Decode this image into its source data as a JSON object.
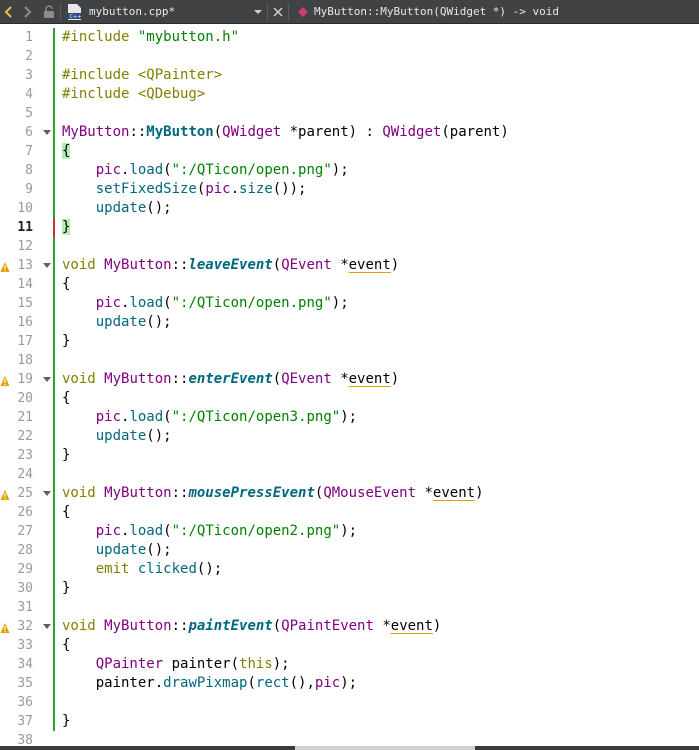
{
  "toolbar": {
    "file_name": "mybutton.cpp*",
    "symbol": "MyButton::MyButton(QWidget *) -> void",
    "file_badge": "C++"
  },
  "lines": [
    {
      "n": "1",
      "tokens": [
        [
          "kw",
          "#include "
        ],
        [
          "str",
          "\"mybutton.h\""
        ]
      ]
    },
    {
      "n": "2",
      "tokens": []
    },
    {
      "n": "3",
      "tokens": [
        [
          "kw",
          "#include "
        ],
        [
          "kw",
          "<QPainter>"
        ]
      ]
    },
    {
      "n": "4",
      "tokens": [
        [
          "kw",
          "#include "
        ],
        [
          "kw",
          "<QDebug>"
        ]
      ]
    },
    {
      "n": "5",
      "tokens": []
    },
    {
      "n": "6",
      "fold": true,
      "tokens": [
        [
          "ty",
          "MyButton"
        ],
        [
          "plain",
          "::"
        ],
        [
          "fnb",
          "MyButton"
        ],
        [
          "plain",
          "("
        ],
        [
          "ty",
          "QWidget"
        ],
        [
          "plain",
          " *parent) : "
        ],
        [
          "ty",
          "QWidget"
        ],
        [
          "plain",
          "(parent)"
        ]
      ]
    },
    {
      "n": "7",
      "tokens": [
        [
          "br",
          "{"
        ]
      ]
    },
    {
      "n": "8",
      "tokens": [
        [
          "plain",
          "    "
        ],
        [
          "ty",
          "pic"
        ],
        [
          "plain",
          "."
        ],
        [
          "fn",
          "load"
        ],
        [
          "plain",
          "("
        ],
        [
          "str",
          "\":/QTicon/open.png\""
        ],
        [
          "plain",
          ");"
        ]
      ]
    },
    {
      "n": "9",
      "tokens": [
        [
          "plain",
          "    "
        ],
        [
          "fn",
          "setFixedSize"
        ],
        [
          "plain",
          "("
        ],
        [
          "ty",
          "pic"
        ],
        [
          "plain",
          "."
        ],
        [
          "fn",
          "size"
        ],
        [
          "plain",
          "());"
        ]
      ]
    },
    {
      "n": "10",
      "tokens": [
        [
          "plain",
          "    "
        ],
        [
          "fn",
          "update"
        ],
        [
          "plain",
          "();"
        ]
      ]
    },
    {
      "n": "11",
      "current": true,
      "tokens": [
        [
          "br",
          "}"
        ]
      ]
    },
    {
      "n": "12",
      "tokens": []
    },
    {
      "n": "13",
      "warn": true,
      "fold": true,
      "tokens": [
        [
          "kw",
          "void "
        ],
        [
          "ty",
          "MyButton"
        ],
        [
          "plain",
          "::"
        ],
        [
          "fni",
          "leaveEvent"
        ],
        [
          "plain",
          "("
        ],
        [
          "ty",
          "QEvent"
        ],
        [
          "plain",
          " *"
        ],
        [
          "prm",
          "event"
        ],
        [
          "plain",
          ")"
        ]
      ]
    },
    {
      "n": "14",
      "tokens": [
        [
          "plain",
          "{"
        ]
      ]
    },
    {
      "n": "15",
      "tokens": [
        [
          "plain",
          "    "
        ],
        [
          "ty",
          "pic"
        ],
        [
          "plain",
          "."
        ],
        [
          "fn",
          "load"
        ],
        [
          "plain",
          "("
        ],
        [
          "str",
          "\":/QTicon/open.png\""
        ],
        [
          "plain",
          ");"
        ]
      ]
    },
    {
      "n": "16",
      "tokens": [
        [
          "plain",
          "    "
        ],
        [
          "fn",
          "update"
        ],
        [
          "plain",
          "();"
        ]
      ]
    },
    {
      "n": "17",
      "tokens": [
        [
          "plain",
          "}"
        ]
      ]
    },
    {
      "n": "18",
      "tokens": []
    },
    {
      "n": "19",
      "warn": true,
      "fold": true,
      "tokens": [
        [
          "kw",
          "void "
        ],
        [
          "ty",
          "MyButton"
        ],
        [
          "plain",
          "::"
        ],
        [
          "fni",
          "enterEvent"
        ],
        [
          "plain",
          "("
        ],
        [
          "ty",
          "QEvent"
        ],
        [
          "plain",
          " *"
        ],
        [
          "prm",
          "event"
        ],
        [
          "plain",
          ")"
        ]
      ]
    },
    {
      "n": "20",
      "tokens": [
        [
          "plain",
          "{"
        ]
      ]
    },
    {
      "n": "21",
      "tokens": [
        [
          "plain",
          "    "
        ],
        [
          "ty",
          "pic"
        ],
        [
          "plain",
          "."
        ],
        [
          "fn",
          "load"
        ],
        [
          "plain",
          "("
        ],
        [
          "str",
          "\":/QTicon/open3.png\""
        ],
        [
          "plain",
          ");"
        ]
      ]
    },
    {
      "n": "22",
      "tokens": [
        [
          "plain",
          "    "
        ],
        [
          "fn",
          "update"
        ],
        [
          "plain",
          "();"
        ]
      ]
    },
    {
      "n": "23",
      "tokens": [
        [
          "plain",
          "}"
        ]
      ]
    },
    {
      "n": "24",
      "tokens": []
    },
    {
      "n": "25",
      "warn": true,
      "fold": true,
      "tokens": [
        [
          "kw",
          "void "
        ],
        [
          "ty",
          "MyButton"
        ],
        [
          "plain",
          "::"
        ],
        [
          "fni",
          "mousePressEvent"
        ],
        [
          "plain",
          "("
        ],
        [
          "ty",
          "QMouseEvent"
        ],
        [
          "plain",
          " *"
        ],
        [
          "prm",
          "event"
        ],
        [
          "plain",
          ")"
        ]
      ]
    },
    {
      "n": "26",
      "tokens": [
        [
          "plain",
          "{"
        ]
      ]
    },
    {
      "n": "27",
      "tokens": [
        [
          "plain",
          "    "
        ],
        [
          "ty",
          "pic"
        ],
        [
          "plain",
          "."
        ],
        [
          "fn",
          "load"
        ],
        [
          "plain",
          "("
        ],
        [
          "str",
          "\":/QTicon/open2.png\""
        ],
        [
          "plain",
          ");"
        ]
      ]
    },
    {
      "n": "28",
      "tokens": [
        [
          "plain",
          "    "
        ],
        [
          "fn",
          "update"
        ],
        [
          "plain",
          "();"
        ]
      ]
    },
    {
      "n": "29",
      "tokens": [
        [
          "plain",
          "    "
        ],
        [
          "kw",
          "emit "
        ],
        [
          "fn",
          "clicked"
        ],
        [
          "plain",
          "();"
        ]
      ]
    },
    {
      "n": "30",
      "tokens": [
        [
          "plain",
          "}"
        ]
      ]
    },
    {
      "n": "31",
      "tokens": []
    },
    {
      "n": "32",
      "warn": true,
      "fold": true,
      "tokens": [
        [
          "kw",
          "void "
        ],
        [
          "ty",
          "MyButton"
        ],
        [
          "plain",
          "::"
        ],
        [
          "fni",
          "paintEvent"
        ],
        [
          "plain",
          "("
        ],
        [
          "ty",
          "QPaintEvent"
        ],
        [
          "plain",
          " *"
        ],
        [
          "prm",
          "event"
        ],
        [
          "plain",
          ")"
        ]
      ]
    },
    {
      "n": "33",
      "tokens": [
        [
          "plain",
          "{"
        ]
      ]
    },
    {
      "n": "34",
      "tokens": [
        [
          "plain",
          "    "
        ],
        [
          "ty",
          "QPainter"
        ],
        [
          "plain",
          " painter("
        ],
        [
          "kw",
          "this"
        ],
        [
          "plain",
          ");"
        ]
      ]
    },
    {
      "n": "35",
      "tokens": [
        [
          "plain",
          "    painter."
        ],
        [
          "fn",
          "drawPixmap"
        ],
        [
          "plain",
          "("
        ],
        [
          "fn",
          "rect"
        ],
        [
          "plain",
          "(),"
        ],
        [
          "ty",
          "pic"
        ],
        [
          "plain",
          ");"
        ]
      ]
    },
    {
      "n": "36",
      "tokens": []
    },
    {
      "n": "37",
      "tokens": [
        [
          "plain",
          "}"
        ]
      ]
    },
    {
      "n": "38",
      "tokens": []
    }
  ],
  "change_marks": [
    {
      "from": "1",
      "to": "10",
      "color": "#2da52d"
    },
    {
      "from": "11",
      "to": "11",
      "color": "#d03030"
    },
    {
      "from": "12",
      "to": "37",
      "color": "#2da52d"
    }
  ],
  "colors": {
    "keyword": "#808000",
    "type": "#800080",
    "string": "#008000",
    "function": "#00677c",
    "warning": "#e0a000"
  }
}
